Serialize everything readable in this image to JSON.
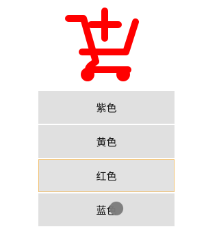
{
  "header": {
    "icon": "cart-plus-icon",
    "icon_color": "#ff0000"
  },
  "options": [
    {
      "label": "紫色"
    },
    {
      "label": "黄色"
    },
    {
      "label": "红色"
    },
    {
      "label": "蓝色"
    }
  ],
  "state": {
    "focused_index": 2
  },
  "colors": {
    "item_bg": "#e0e0e0",
    "focus_border": "#f0c070",
    "touch_indicator": "#7b7b7b"
  }
}
